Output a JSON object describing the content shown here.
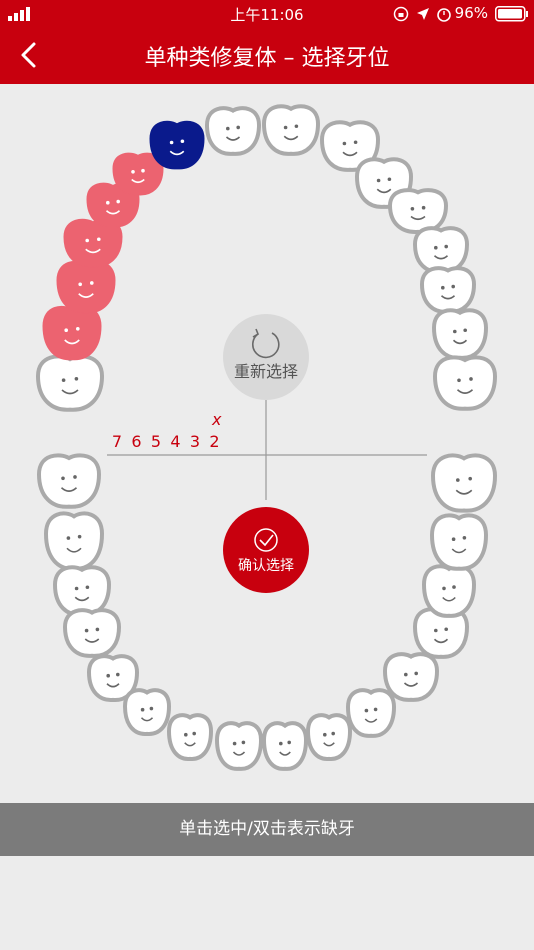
{
  "status_bar": {
    "time": "上午11:06",
    "battery": "96%"
  },
  "nav": {
    "title": "单种类修复体 – 选择牙位",
    "back_icon": "chevron-left-icon"
  },
  "colors": {
    "brand_red": "#c8000e",
    "selected_pink": "#ec6370",
    "active_blue": "#0a1a8c",
    "tooth_outline": "#aaaaaa",
    "bottom_bar": "#7b7b7b"
  },
  "reset_button": {
    "label": "重新选择",
    "icon": "refresh-icon"
  },
  "confirm_button": {
    "label": "确认选择",
    "icon": "check-circle-icon"
  },
  "quadrant_marker": "x",
  "tooth_numbers": [
    "7",
    "6",
    "5",
    "4",
    "3",
    "2"
  ],
  "hint_bar": "单击选中/双击表示缺牙",
  "teeth": {
    "upper": [
      {
        "state": "normal"
      },
      {
        "state": "selected"
      },
      {
        "state": "selected"
      },
      {
        "state": "selected"
      },
      {
        "state": "selected"
      },
      {
        "state": "selected"
      },
      {
        "state": "active"
      },
      {
        "state": "normal"
      },
      {
        "state": "normal"
      },
      {
        "state": "normal"
      },
      {
        "state": "normal"
      },
      {
        "state": "normal"
      },
      {
        "state": "normal"
      },
      {
        "state": "normal"
      },
      {
        "state": "normal"
      },
      {
        "state": "normal"
      }
    ],
    "lower": [
      {
        "state": "normal"
      },
      {
        "state": "normal"
      },
      {
        "state": "normal"
      },
      {
        "state": "normal"
      },
      {
        "state": "normal"
      },
      {
        "state": "normal"
      },
      {
        "state": "normal"
      },
      {
        "state": "normal"
      },
      {
        "state": "normal"
      },
      {
        "state": "normal"
      },
      {
        "state": "normal"
      },
      {
        "state": "normal"
      },
      {
        "state": "normal"
      },
      {
        "state": "normal"
      },
      {
        "state": "normal"
      },
      {
        "state": "normal"
      }
    ]
  }
}
